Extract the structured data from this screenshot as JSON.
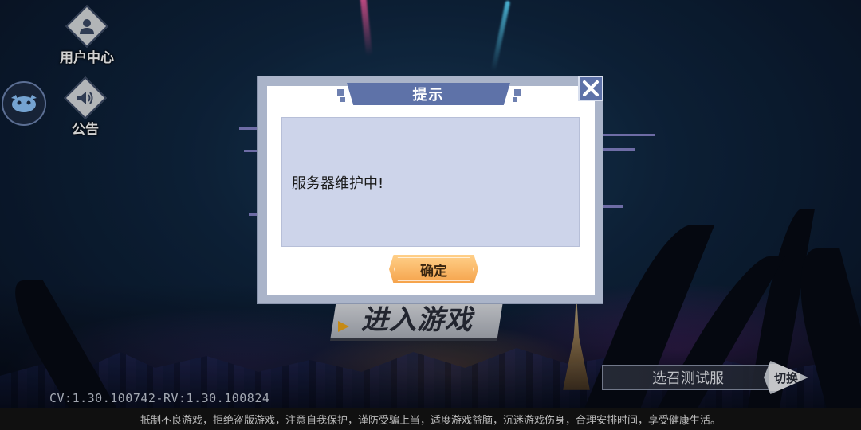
{
  "side_menu": {
    "user_center_label": "用户中心",
    "notice_label": "公告"
  },
  "main": {
    "enter_game_label": "进入游戏",
    "server_name": "选召测试服",
    "switch_label": "切换",
    "version_text": "CV:1.30.100742-RV:1.30.100824"
  },
  "footer": {
    "notice": "抵制不良游戏，拒绝盗版游戏，注意自我保护，谨防受骗上当，适度游戏益脑，沉迷游戏伤身，合理安排时间，享受健康生活。"
  },
  "dialog": {
    "title": "提示",
    "message": "服务器维护中!",
    "confirm_label": "确定"
  },
  "icons": {
    "user": "user-icon",
    "speaker": "speaker-icon",
    "avatar": "pet-avatar-icon",
    "close": "close-icon"
  }
}
